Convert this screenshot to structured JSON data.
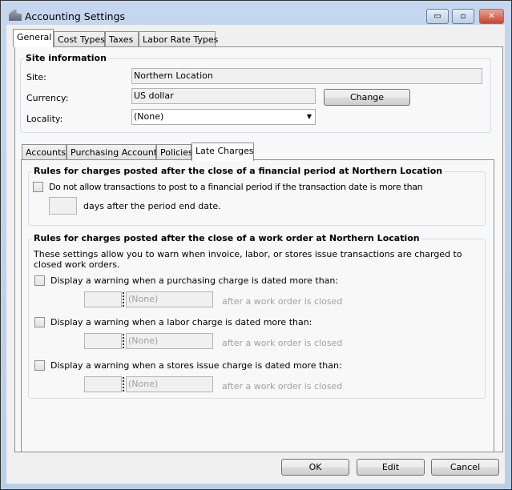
{
  "window": {
    "title": "Accounting Settings",
    "minimize": "▭",
    "maximize": "▫",
    "close": "✕"
  },
  "tabs": [
    "General",
    "Cost Types",
    "Taxes",
    "Labor Rate Types"
  ],
  "site_info": {
    "title": "Site information",
    "site_label": "Site:",
    "site_value": "Northern Location",
    "currency_label": "Currency:",
    "currency_value": "US dollar",
    "change_button": "Change",
    "locality_label": "Locality:",
    "locality_value": "(None)"
  },
  "subtabs": [
    "Accounts",
    "Purchasing Accounts",
    "Policies",
    "Late Charges"
  ],
  "financial": {
    "title": "Rules for charges posted after the close of a financial period at Northern Location",
    "checkbox_label": "Do not allow transactions to post to a financial period if the transaction date is more than",
    "days_value": "",
    "days_suffix": "days after the period end date."
  },
  "workorder": {
    "title": "Rules for charges posted after the close of a work order at Northern Location",
    "description": "These settings allow you to warn when invoice, labor, or stores issue transactions are charged to closed work orders.",
    "rules": [
      {
        "label": "Display a warning when a purchasing charge is dated more than:",
        "amount": "",
        "unit": "(None)",
        "suffix": "after a work order is closed"
      },
      {
        "label": "Display a warning when a labor charge is dated more than:",
        "amount": "",
        "unit": "(None)",
        "suffix": "after a work order is closed"
      },
      {
        "label": "Display a warning when a stores issue charge is dated more than:",
        "amount": "",
        "unit": "(None)",
        "suffix": "after a work order is closed"
      }
    ]
  },
  "buttons": {
    "ok": "OK",
    "edit": "Edit",
    "cancel": "Cancel"
  }
}
